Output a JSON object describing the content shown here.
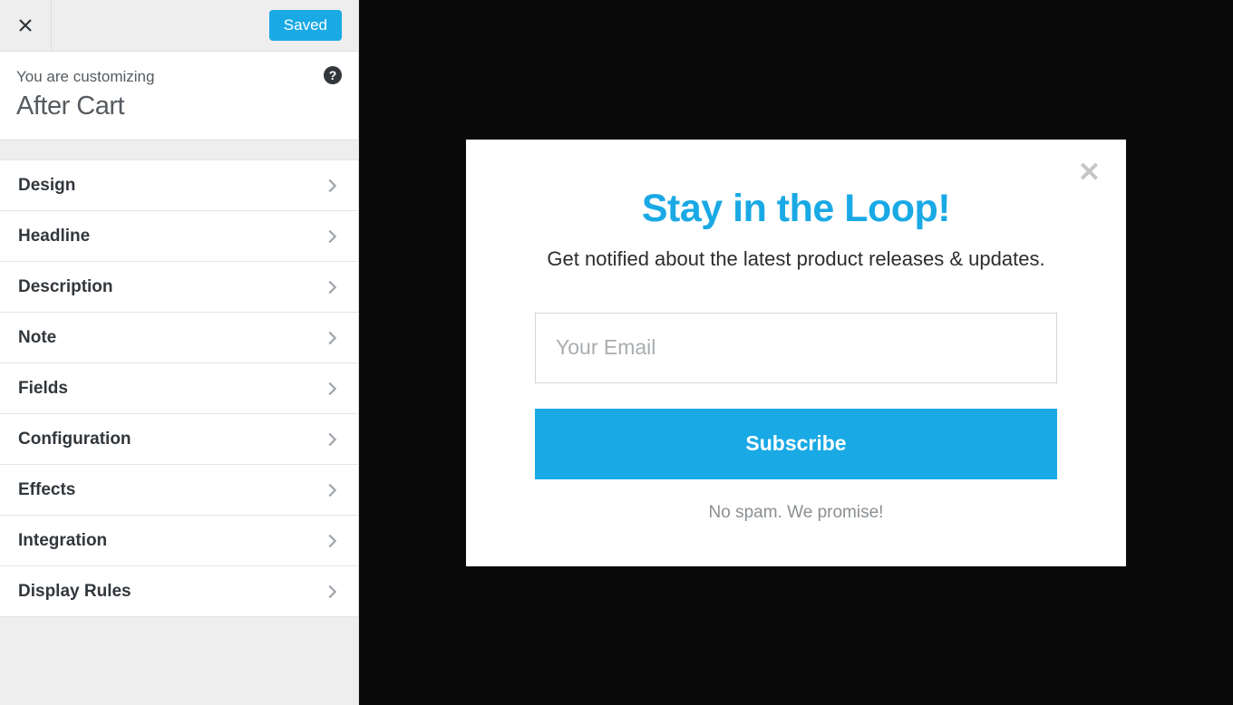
{
  "sidebar": {
    "saved_label": "Saved",
    "customizing_pre": "You are customizing",
    "customizing_title": "After Cart",
    "help_glyph": "?",
    "items": [
      {
        "label": "Design"
      },
      {
        "label": "Headline"
      },
      {
        "label": "Description"
      },
      {
        "label": "Note"
      },
      {
        "label": "Fields"
      },
      {
        "label": "Configuration"
      },
      {
        "label": "Effects"
      },
      {
        "label": "Integration"
      },
      {
        "label": "Display Rules"
      }
    ]
  },
  "popup": {
    "close_glyph": "✕",
    "headline": "Stay in the Loop!",
    "description": "Get notified about the latest product releases & updates.",
    "email_placeholder": "Your Email",
    "email_value": "",
    "subscribe_label": "Subscribe",
    "note": "No spam. We promise!"
  }
}
